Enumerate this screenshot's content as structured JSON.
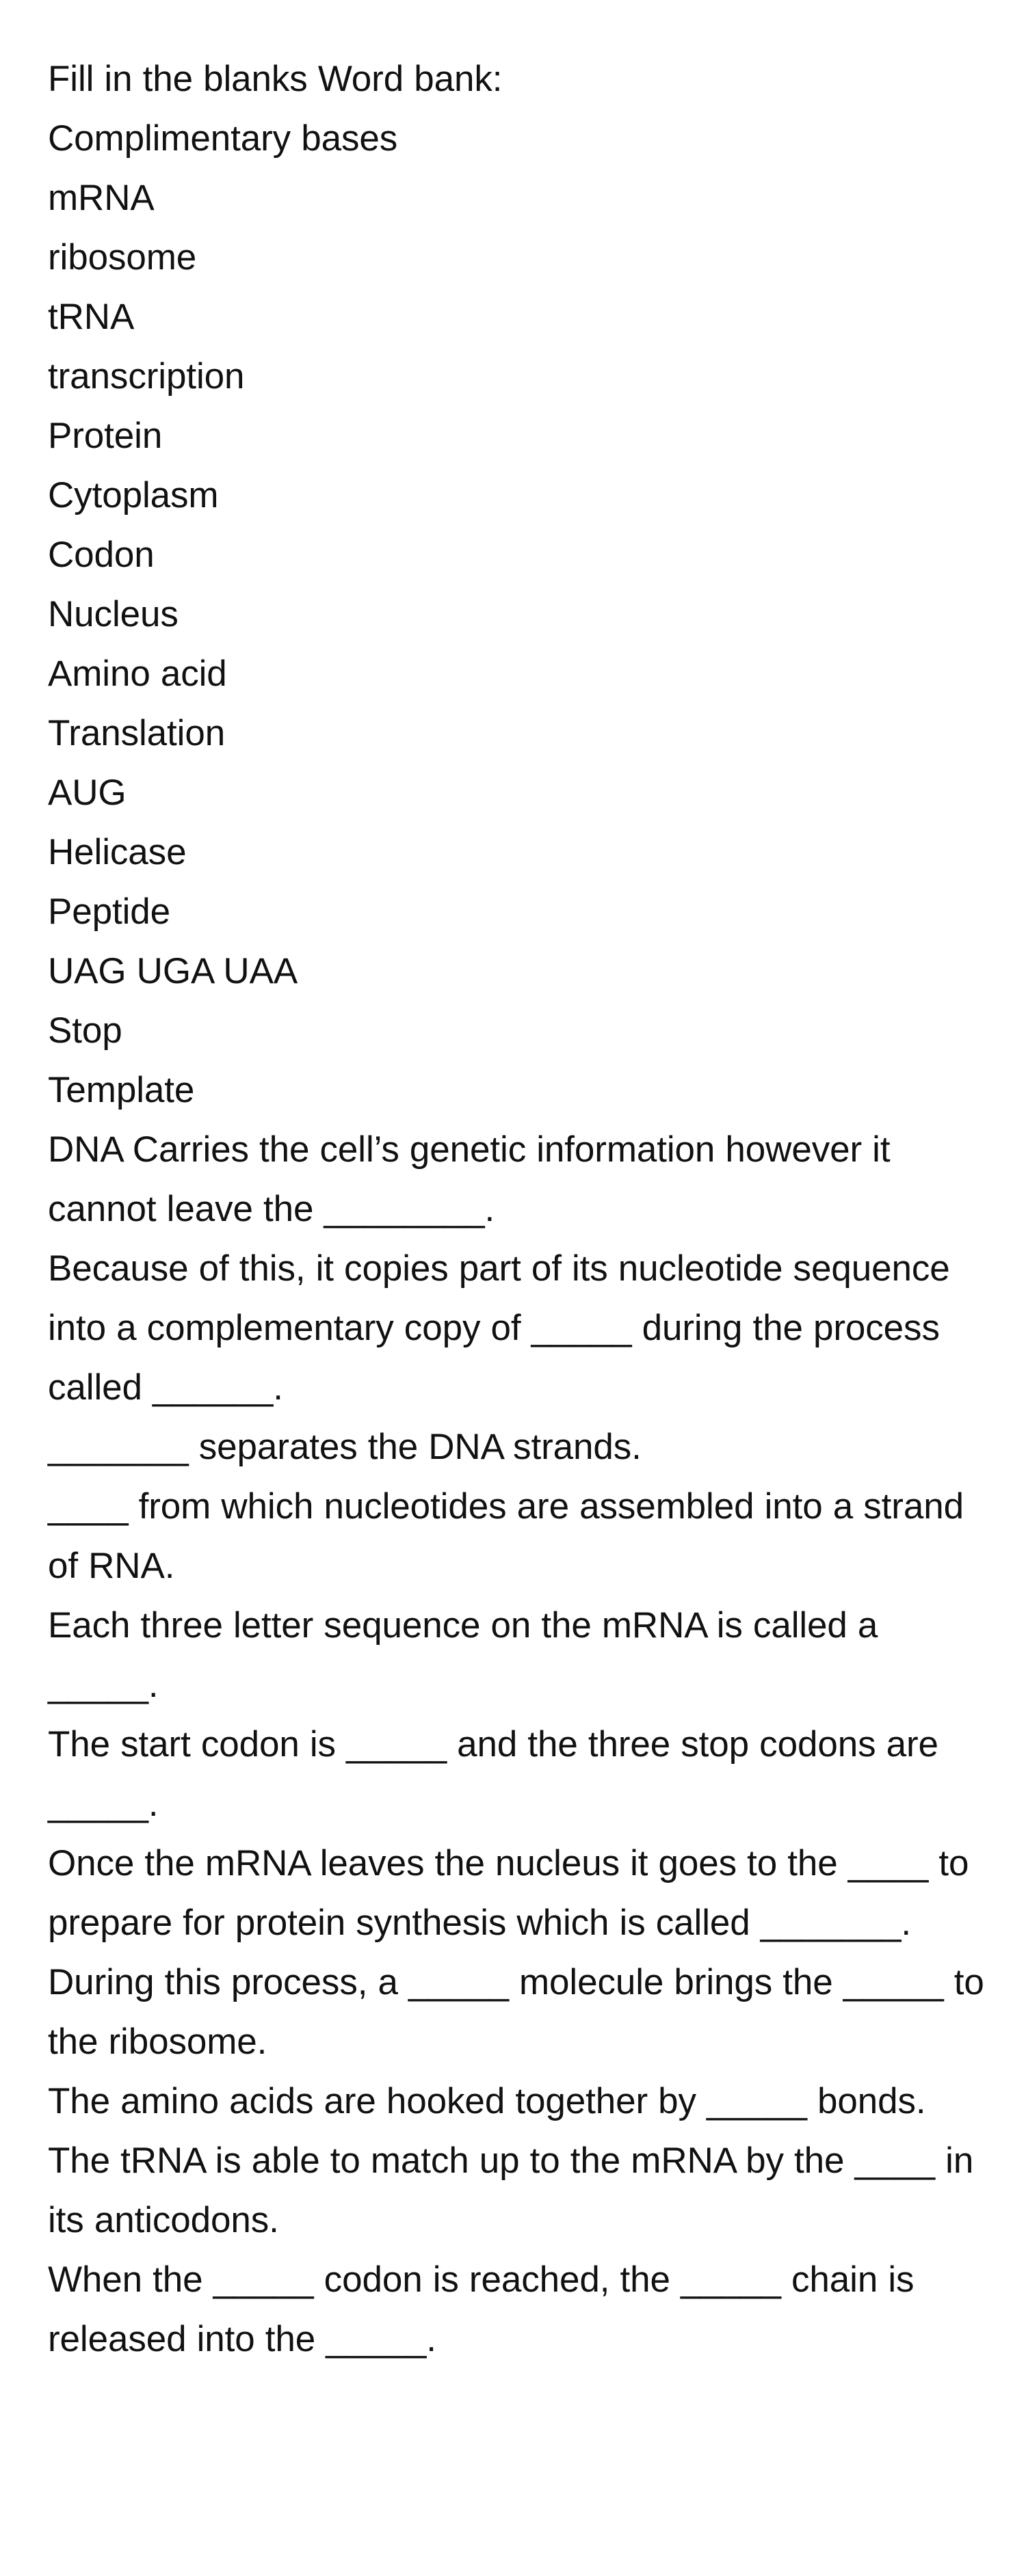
{
  "document": {
    "title_line": "Fill in the blanks Word bank:",
    "word_bank": [
      "Complimentary bases",
      "mRNA",
      "ribosome",
      "tRNA",
      "transcription",
      "Protein",
      "Cytoplasm",
      "Codon",
      "Nucleus",
      "Amino acid",
      "Translation",
      "AUG",
      "Helicase",
      "Peptide",
      "UAG UGA UAA",
      "Stop",
      "Template"
    ],
    "sentences": [
      "DNA Carries the cell’s genetic information however it cannot leave the ________.",
      "Because of this, it copies part of its nucleotide sequence into a complementary copy of _____ during the process called ______.",
      "_______ separates the DNA strands.",
      "____ from which nucleotides are assembled into a strand of RNA.",
      "Each three letter sequence on the mRNA is called a _____.",
      "The start codon is _____ and the three stop codons are _____.",
      "Once the mRNA leaves the nucleus it goes to the ____ to prepare for protein synthesis which is called _______.",
      "During this process, a _____ molecule brings the _____ to the ribosome.",
      "The amino acids are hooked together by _____ bonds.",
      "The tRNA is able to match up to the mRNA by the ____ in its anticodons.",
      "When the _____ codon is reached, the _____ chain is released into the _____."
    ],
    "colors": {
      "page_background": "#ffffff",
      "text": "#111111"
    }
  }
}
